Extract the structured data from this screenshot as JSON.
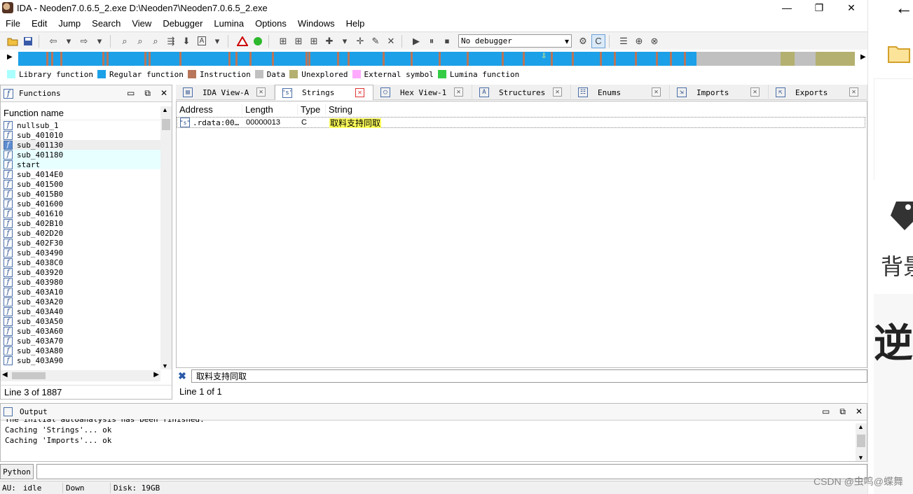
{
  "window": {
    "title": "IDA - Neoden7.0.6.5_2.exe D:\\Neoden7\\Neoden7.0.6.5_2.exe",
    "controls": [
      "—",
      "❐",
      "✕"
    ]
  },
  "menu": [
    "File",
    "Edit",
    "Jump",
    "Search",
    "View",
    "Debugger",
    "Lumina",
    "Options",
    "Windows",
    "Help"
  ],
  "toolbar": {
    "debugger_select": "No debugger"
  },
  "legend": [
    {
      "label": "Library function",
      "color": "#aaffff"
    },
    {
      "label": "Regular function",
      "color": "#1ca0e8"
    },
    {
      "label": "Instruction",
      "color": "#b8765a"
    },
    {
      "label": "Data",
      "color": "#c0c0c0"
    },
    {
      "label": "Unexplored",
      "color": "#b4b070"
    },
    {
      "label": "External symbol",
      "color": "#ffaaff"
    },
    {
      "label": "Lumina function",
      "color": "#33cc44"
    }
  ],
  "functions_panel": {
    "title": "Functions",
    "column": "Function name",
    "items": [
      "nullsub_1",
      "sub_401010",
      "sub_401130",
      "sub_401180",
      "start",
      "sub_4014E0",
      "sub_401500",
      "sub_4015B0",
      "sub_401600",
      "sub_401610",
      "sub_402B10",
      "sub_402D20",
      "sub_402F30",
      "sub_403490",
      "sub_4038C0",
      "sub_403920",
      "sub_403980",
      "sub_403A10",
      "sub_403A20",
      "sub_403A40",
      "sub_403A50",
      "sub_403A60",
      "sub_403A70",
      "sub_403A80",
      "sub_403A90"
    ],
    "status": "Line 3 of 1887"
  },
  "tabs": [
    {
      "label": "IDA View-A",
      "icon": "ida-view-icon"
    },
    {
      "label": "Strings",
      "icon": "strings-icon"
    },
    {
      "label": "Hex View-1",
      "icon": "hex-view-icon"
    },
    {
      "label": "Structures",
      "icon": "structures-icon"
    },
    {
      "label": "Enums",
      "icon": "enums-icon"
    },
    {
      "label": "Imports",
      "icon": "imports-icon"
    },
    {
      "label": "Exports",
      "icon": "exports-icon"
    }
  ],
  "strings_view": {
    "columns": [
      "Address",
      "Length",
      "Type",
      "String"
    ],
    "rows": [
      {
        "address": ".rdata:00…",
        "length": "00000013",
        "type": "C",
        "string": "取料支持同取"
      }
    ],
    "filter": "取料支持同取",
    "status": "Line 1 of 1"
  },
  "output": {
    "title": "Output",
    "lines": [
      "The initial autoanalysis has been finished.",
      "Caching 'Strings'... ok",
      "Caching 'Imports'... ok"
    ]
  },
  "python_button": "Python",
  "status_bar": {
    "au": "AU:",
    "state": "idle",
    "direction": "Down",
    "disk": "Disk: 19GB"
  },
  "side": {
    "text1": "背景",
    "text2": "逆"
  },
  "watermark": "CSDN @虫鸣@蝶舞"
}
